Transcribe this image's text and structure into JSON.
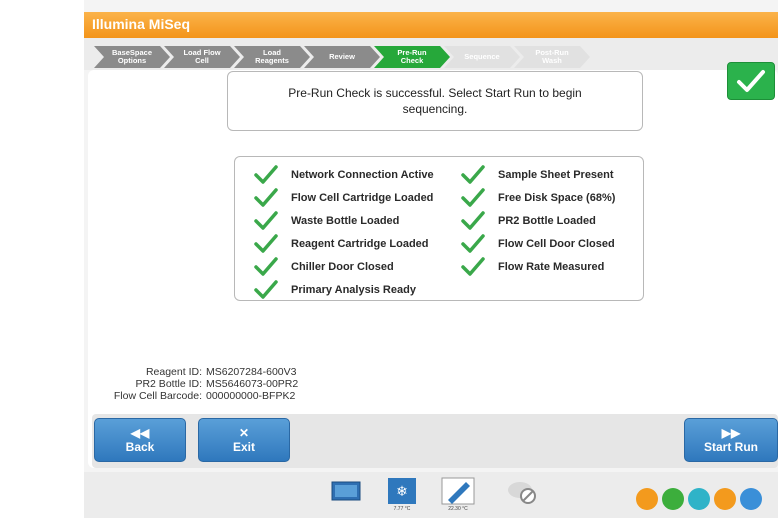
{
  "app": {
    "title": "Illumina MiSeq"
  },
  "steps": [
    {
      "label": "BaseSpace\nOptions",
      "state": "done"
    },
    {
      "label": "Load Flow\nCell",
      "state": "done"
    },
    {
      "label": "Load\nReagents",
      "state": "done"
    },
    {
      "label": "Review",
      "state": "done"
    },
    {
      "label": "Pre-Run\nCheck",
      "state": "active"
    },
    {
      "label": "Sequence",
      "state": "todo"
    },
    {
      "label": "Post-Run\nWash",
      "state": "todo"
    }
  ],
  "message": "Pre-Run Check is successful. Select Start Run to begin sequencing.",
  "checks_left": [
    "Network Connection Active",
    "Flow Cell Cartridge Loaded",
    "Waste Bottle Loaded",
    "Reagent Cartridge Loaded",
    "Chiller Door Closed",
    "Primary Analysis Ready"
  ],
  "checks_right": [
    "Sample Sheet Present",
    "Free Disk Space (68%)",
    "PR2 Bottle Loaded",
    "Flow Cell Door Closed",
    "Flow Rate Measured"
  ],
  "ids": [
    {
      "key": "Reagent ID:",
      "value": "MS6207284-600V3"
    },
    {
      "key": "PR2 Bottle ID:",
      "value": "MS5646073-00PR2"
    },
    {
      "key": "Flow Cell Barcode:",
      "value": "000000000-BFPK2"
    }
  ],
  "buttons": {
    "back": "Back",
    "exit": "Exit",
    "start": "Start Run"
  },
  "tray": {
    "temp1": "7.77 °C",
    "temp2": "22.30 °C"
  },
  "colors": {
    "accent": "#f3941a",
    "active_step": "#26a83a",
    "button_blue": "#2f78bd",
    "check_green": "#2bb24c"
  }
}
